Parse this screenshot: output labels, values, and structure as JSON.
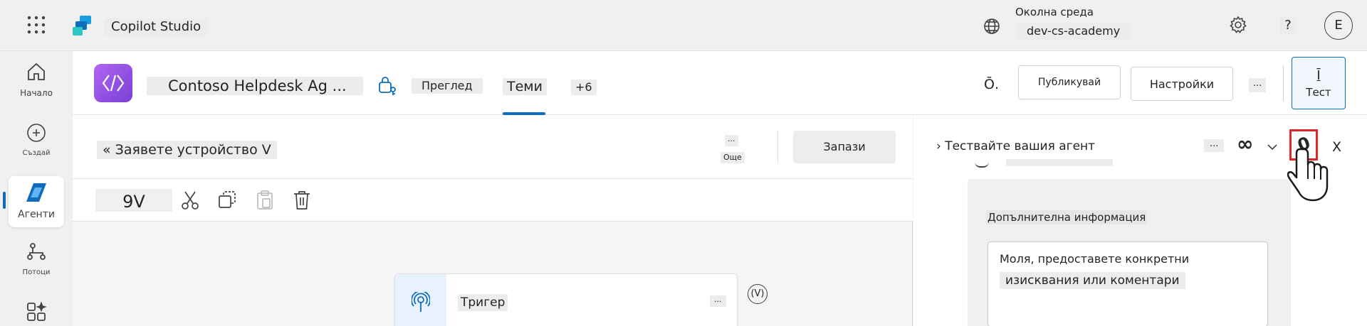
{
  "topbar": {
    "app_title": "Copilot Studio",
    "environment_label": "Околна среда",
    "environment_value": "dev-cs-academy",
    "help_label": "?",
    "avatar_initial": "E"
  },
  "rail": {
    "items": [
      {
        "label": "Начало",
        "icon": "home-icon"
      },
      {
        "label": "Създай",
        "icon": "plus-circle-icon"
      },
      {
        "label": "Агенти",
        "icon": "agents-icon"
      },
      {
        "label": "Потоци",
        "icon": "flow-icon"
      },
      {
        "label": "",
        "icon": "apps-icon"
      }
    ]
  },
  "agent": {
    "name": "Contoso Helpdesk Ag ...",
    "tabs": [
      {
        "label": "Преглед"
      },
      {
        "label": "Теми"
      },
      {
        "label": "+6"
      }
    ],
    "small_glyph": "Ō.",
    "publish_label": "Публикувай",
    "settings_label": "Настройки",
    "more_label": "...",
    "test_label": "Тест",
    "test_glyph": "Ī"
  },
  "editor": {
    "topic_title": "« Заявете устройство V",
    "more_label": "...",
    "more_caption": "Още",
    "save_label": "Запази",
    "zoom_label": "9V",
    "trigger_label": "Тригер",
    "trigger_more": "...",
    "variable_badge": "(V)"
  },
  "test_panel": {
    "title": "› Тествайте вашия агент",
    "more_label": "...",
    "loop_glyph": "∞",
    "reset_glyph": "0",
    "close_label": "X",
    "card_title": "Допълнителна информация",
    "input_text_line1": "Моля, предоставете конкретни",
    "input_text_line2": "изисквания или коментари"
  },
  "colors": {
    "accent": "#0f6cbd",
    "agent_icon": "#8c4fe0",
    "highlight_box": "#e0262b"
  }
}
